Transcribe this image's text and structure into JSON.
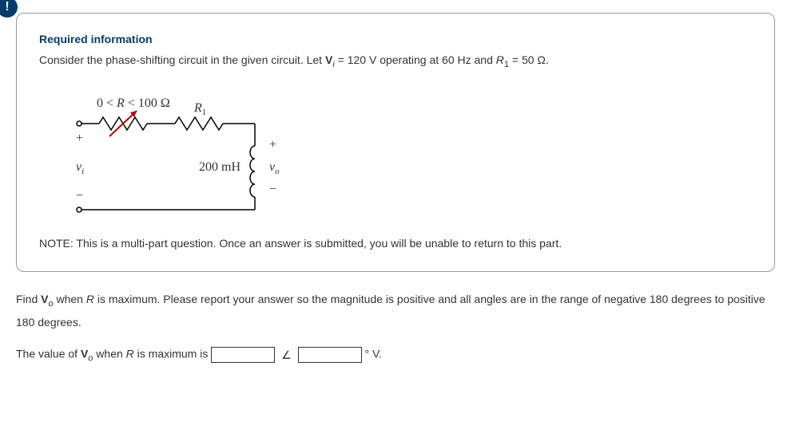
{
  "badge_icon": "!",
  "required": {
    "title": "Required information",
    "text_before_vi": "Consider the phase-shifting circuit in the given circuit. Let ",
    "vi_bold": "V",
    "vi_sub": "i",
    "text_mid": " = 120 V operating at 60 Hz and ",
    "r1_var": "R",
    "r1_sub": "1",
    "text_after": " = 50 Ω."
  },
  "circuit": {
    "r_range_pre": "0 < ",
    "r_range_var": "R",
    "r_range_post": " < 100 Ω",
    "r1_label_var": "R",
    "r1_label_sub": "1",
    "l_value": "200 mH",
    "vi_var": "v",
    "vi_sub": "i",
    "vo_var": "v",
    "vo_sub": "o",
    "plus": "+",
    "minus": "−"
  },
  "note": "NOTE: This is a multi-part question. Once an answer is submitted, you will be unable to return to this part.",
  "question": {
    "line1_pre": "Find ",
    "vo_bold": "V",
    "vo_sub": "o",
    "line1_mid": " when ",
    "r_var": "R",
    "line1_post": " is maximum. Please report your answer so the magnitude is positive and all angles are in the range of negative 180 degrees to positive 180 degrees.",
    "answer_pre": "The value of ",
    "answer_mid": " when ",
    "answer_post": " is maximum is ",
    "angle_sym": "∠",
    "unit": "° V."
  }
}
